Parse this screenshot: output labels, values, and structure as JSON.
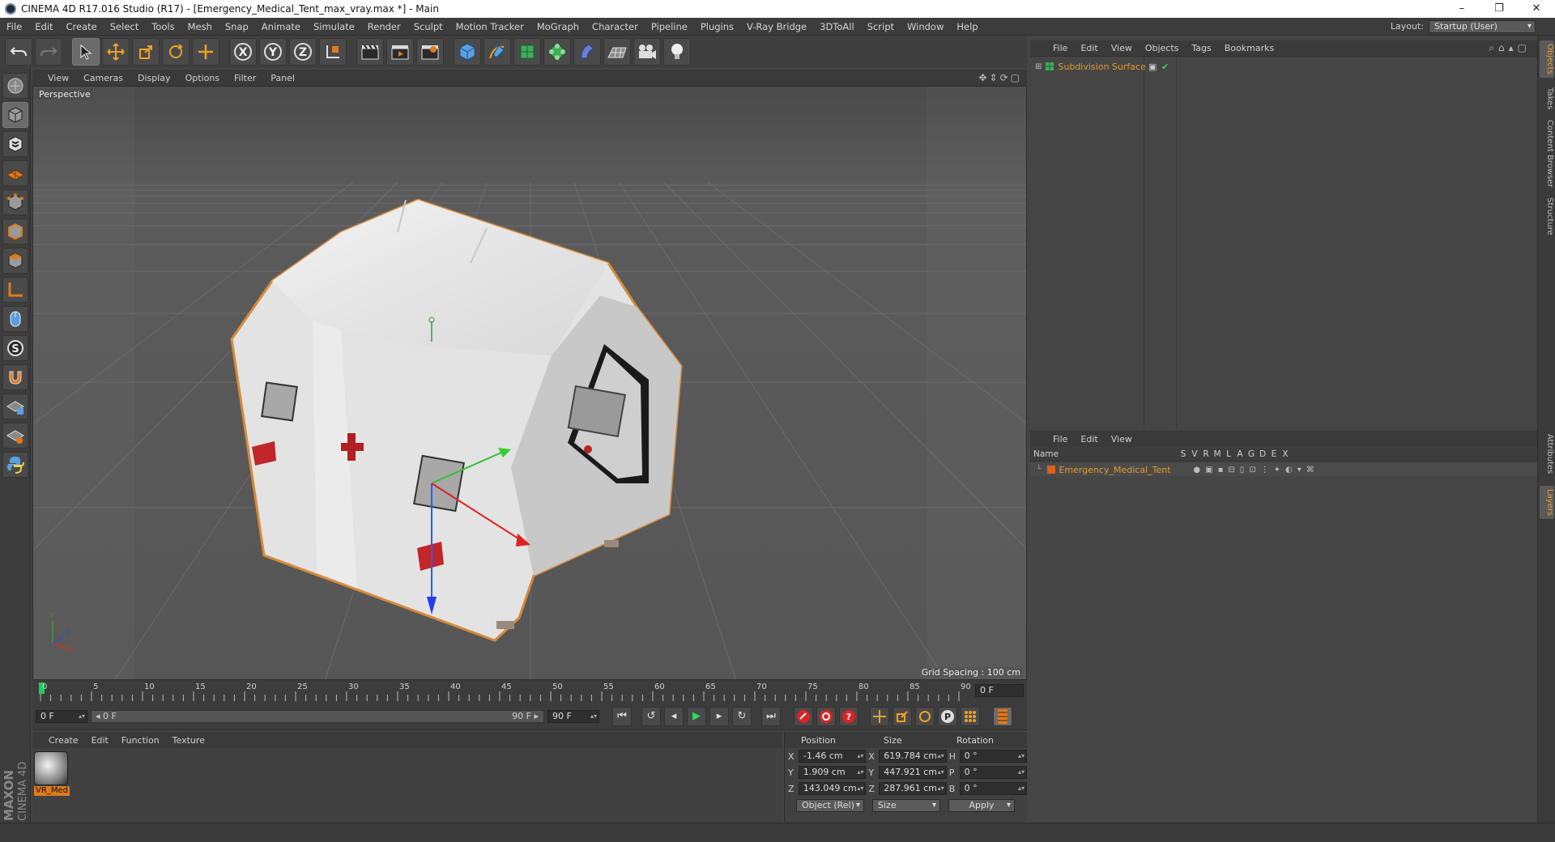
{
  "window": {
    "title": "CINEMA 4D R17.016 Studio (R17) - [Emergency_Medical_Tent_max_vray.max *] - Main",
    "controls": [
      "–",
      "❐",
      "✕"
    ]
  },
  "menubar": {
    "items": [
      "File",
      "Edit",
      "Create",
      "Select",
      "Tools",
      "Mesh",
      "Snap",
      "Animate",
      "Simulate",
      "Render",
      "Sculpt",
      "Motion Tracker",
      "MoGraph",
      "Character",
      "Pipeline",
      "Plugins",
      "V-Ray Bridge",
      "3DToAll",
      "Script",
      "Window",
      "Help"
    ],
    "layout_label": "Layout:",
    "layout_value": "Startup (User)"
  },
  "viewport": {
    "menu": [
      "View",
      "Cameras",
      "Display",
      "Options",
      "Filter",
      "Panel"
    ],
    "camera_label": "Perspective",
    "grid_spacing": "Grid Spacing : 100 cm",
    "axis_labels": {
      "y": "Y",
      "x": "X",
      "z": "Z"
    }
  },
  "timeline": {
    "ticks": [
      "0",
      "5",
      "10",
      "15",
      "20",
      "25",
      "30",
      "35",
      "40",
      "45",
      "50",
      "55",
      "60",
      "65",
      "70",
      "75",
      "80",
      "85",
      "90"
    ],
    "current_frame_display": "0 F",
    "start_field": "0 F",
    "range_start": "◂ 0 F",
    "range_end": "90 F ▸",
    "end_field": "90 F"
  },
  "materials": {
    "menu": [
      "Create",
      "Edit",
      "Function",
      "Texture"
    ],
    "items": [
      {
        "name": "VR_Med"
      }
    ]
  },
  "coordinates": {
    "headers": {
      "position": "Position",
      "size": "Size",
      "rotation": "Rotation"
    },
    "rows": [
      {
        "axis": "X",
        "pos": "-1.46 cm",
        "size_axis": "X",
        "size": "619.784 cm",
        "rot_axis": "H",
        "rot": "0 °"
      },
      {
        "axis": "Y",
        "pos": "1.909 cm",
        "size_axis": "Y",
        "size": "447.921 cm",
        "rot_axis": "P",
        "rot": "0 °"
      },
      {
        "axis": "Z",
        "pos": "143.049 cm",
        "size_axis": "Z",
        "size": "287.961 cm",
        "rot_axis": "B",
        "rot": "0 °"
      }
    ],
    "mode_dropdown": "Object (Rel)",
    "size_dropdown": "Size",
    "apply_label": "Apply"
  },
  "objects": {
    "menu": [
      "File",
      "Edit",
      "View",
      "Objects",
      "Tags",
      "Bookmarks"
    ],
    "items": [
      {
        "name": "Subdivision Surface"
      }
    ]
  },
  "layers": {
    "menu": [
      "File",
      "Edit",
      "View"
    ],
    "header_name": "Name",
    "header_flags": [
      "S",
      "V",
      "R",
      "M",
      "L",
      "A",
      "G",
      "D",
      "E",
      "X"
    ],
    "items": [
      {
        "name": "Emergency_Medical_Tent",
        "color": "#e0601c"
      }
    ]
  },
  "right_tabs": [
    "Objects",
    "Takes",
    "Content Browser",
    "Structure",
    "Attributes",
    "Layers"
  ],
  "branding": {
    "line1": "MAXON",
    "line2": "CINEMA 4D"
  },
  "colors": {
    "accent": "#e39a32",
    "selection": "#e07a1c"
  }
}
